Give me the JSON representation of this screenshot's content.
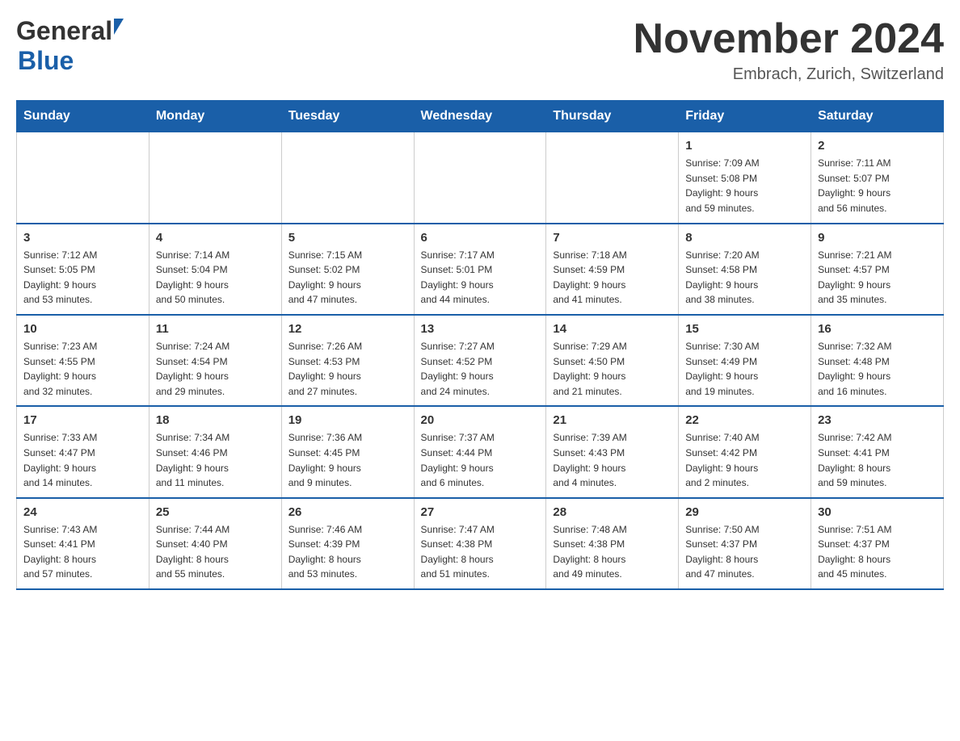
{
  "header": {
    "logo_general": "General",
    "logo_blue": "Blue",
    "month_title": "November 2024",
    "location": "Embrach, Zurich, Switzerland"
  },
  "weekdays": [
    "Sunday",
    "Monday",
    "Tuesday",
    "Wednesday",
    "Thursday",
    "Friday",
    "Saturday"
  ],
  "weeks": [
    [
      {
        "day": "",
        "info": ""
      },
      {
        "day": "",
        "info": ""
      },
      {
        "day": "",
        "info": ""
      },
      {
        "day": "",
        "info": ""
      },
      {
        "day": "",
        "info": ""
      },
      {
        "day": "1",
        "info": "Sunrise: 7:09 AM\nSunset: 5:08 PM\nDaylight: 9 hours\nand 59 minutes."
      },
      {
        "day": "2",
        "info": "Sunrise: 7:11 AM\nSunset: 5:07 PM\nDaylight: 9 hours\nand 56 minutes."
      }
    ],
    [
      {
        "day": "3",
        "info": "Sunrise: 7:12 AM\nSunset: 5:05 PM\nDaylight: 9 hours\nand 53 minutes."
      },
      {
        "day": "4",
        "info": "Sunrise: 7:14 AM\nSunset: 5:04 PM\nDaylight: 9 hours\nand 50 minutes."
      },
      {
        "day": "5",
        "info": "Sunrise: 7:15 AM\nSunset: 5:02 PM\nDaylight: 9 hours\nand 47 minutes."
      },
      {
        "day": "6",
        "info": "Sunrise: 7:17 AM\nSunset: 5:01 PM\nDaylight: 9 hours\nand 44 minutes."
      },
      {
        "day": "7",
        "info": "Sunrise: 7:18 AM\nSunset: 4:59 PM\nDaylight: 9 hours\nand 41 minutes."
      },
      {
        "day": "8",
        "info": "Sunrise: 7:20 AM\nSunset: 4:58 PM\nDaylight: 9 hours\nand 38 minutes."
      },
      {
        "day": "9",
        "info": "Sunrise: 7:21 AM\nSunset: 4:57 PM\nDaylight: 9 hours\nand 35 minutes."
      }
    ],
    [
      {
        "day": "10",
        "info": "Sunrise: 7:23 AM\nSunset: 4:55 PM\nDaylight: 9 hours\nand 32 minutes."
      },
      {
        "day": "11",
        "info": "Sunrise: 7:24 AM\nSunset: 4:54 PM\nDaylight: 9 hours\nand 29 minutes."
      },
      {
        "day": "12",
        "info": "Sunrise: 7:26 AM\nSunset: 4:53 PM\nDaylight: 9 hours\nand 27 minutes."
      },
      {
        "day": "13",
        "info": "Sunrise: 7:27 AM\nSunset: 4:52 PM\nDaylight: 9 hours\nand 24 minutes."
      },
      {
        "day": "14",
        "info": "Sunrise: 7:29 AM\nSunset: 4:50 PM\nDaylight: 9 hours\nand 21 minutes."
      },
      {
        "day": "15",
        "info": "Sunrise: 7:30 AM\nSunset: 4:49 PM\nDaylight: 9 hours\nand 19 minutes."
      },
      {
        "day": "16",
        "info": "Sunrise: 7:32 AM\nSunset: 4:48 PM\nDaylight: 9 hours\nand 16 minutes."
      }
    ],
    [
      {
        "day": "17",
        "info": "Sunrise: 7:33 AM\nSunset: 4:47 PM\nDaylight: 9 hours\nand 14 minutes."
      },
      {
        "day": "18",
        "info": "Sunrise: 7:34 AM\nSunset: 4:46 PM\nDaylight: 9 hours\nand 11 minutes."
      },
      {
        "day": "19",
        "info": "Sunrise: 7:36 AM\nSunset: 4:45 PM\nDaylight: 9 hours\nand 9 minutes."
      },
      {
        "day": "20",
        "info": "Sunrise: 7:37 AM\nSunset: 4:44 PM\nDaylight: 9 hours\nand 6 minutes."
      },
      {
        "day": "21",
        "info": "Sunrise: 7:39 AM\nSunset: 4:43 PM\nDaylight: 9 hours\nand 4 minutes."
      },
      {
        "day": "22",
        "info": "Sunrise: 7:40 AM\nSunset: 4:42 PM\nDaylight: 9 hours\nand 2 minutes."
      },
      {
        "day": "23",
        "info": "Sunrise: 7:42 AM\nSunset: 4:41 PM\nDaylight: 8 hours\nand 59 minutes."
      }
    ],
    [
      {
        "day": "24",
        "info": "Sunrise: 7:43 AM\nSunset: 4:41 PM\nDaylight: 8 hours\nand 57 minutes."
      },
      {
        "day": "25",
        "info": "Sunrise: 7:44 AM\nSunset: 4:40 PM\nDaylight: 8 hours\nand 55 minutes."
      },
      {
        "day": "26",
        "info": "Sunrise: 7:46 AM\nSunset: 4:39 PM\nDaylight: 8 hours\nand 53 minutes."
      },
      {
        "day": "27",
        "info": "Sunrise: 7:47 AM\nSunset: 4:38 PM\nDaylight: 8 hours\nand 51 minutes."
      },
      {
        "day": "28",
        "info": "Sunrise: 7:48 AM\nSunset: 4:38 PM\nDaylight: 8 hours\nand 49 minutes."
      },
      {
        "day": "29",
        "info": "Sunrise: 7:50 AM\nSunset: 4:37 PM\nDaylight: 8 hours\nand 47 minutes."
      },
      {
        "day": "30",
        "info": "Sunrise: 7:51 AM\nSunset: 4:37 PM\nDaylight: 8 hours\nand 45 minutes."
      }
    ]
  ]
}
